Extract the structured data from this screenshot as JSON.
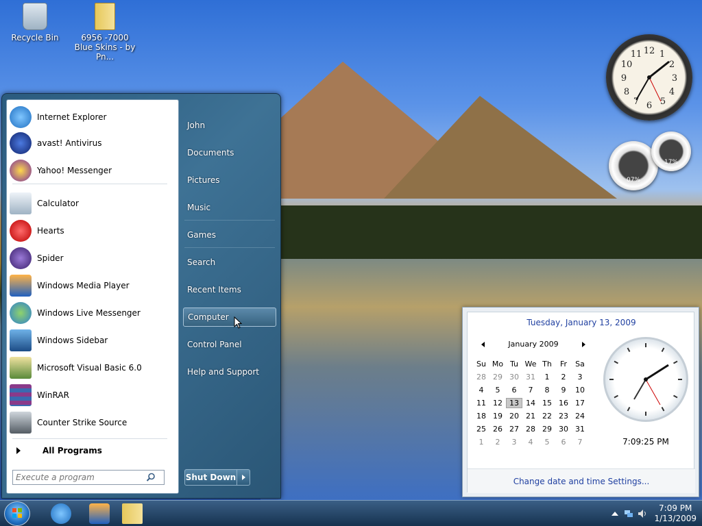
{
  "desktop": {
    "icons": [
      {
        "label": "Recycle Bin"
      },
      {
        "label": "6956 -7000 Blue Skins - by Pn..."
      }
    ]
  },
  "start_menu": {
    "pinned": [
      {
        "label": "Internet Explorer",
        "icon": "ie-icon"
      },
      {
        "label": "avast! Antivirus",
        "icon": "avast-icon"
      },
      {
        "label": "Yahoo! Messenger",
        "icon": "yahoo-icon"
      }
    ],
    "recent": [
      {
        "label": "Calculator",
        "icon": "calculator-icon"
      },
      {
        "label": "Hearts",
        "icon": "hearts-icon"
      },
      {
        "label": "Spider",
        "icon": "spider-icon"
      },
      {
        "label": "Windows Media Player",
        "icon": "media-player-icon"
      },
      {
        "label": "Windows Live Messenger",
        "icon": "messenger-icon"
      },
      {
        "label": "Windows Sidebar",
        "icon": "sidebar-icon"
      },
      {
        "label": "Microsoft Visual Basic 6.0",
        "icon": "vb-icon"
      },
      {
        "label": "WinRAR",
        "icon": "winrar-icon"
      },
      {
        "label": "Counter Strike Source",
        "icon": "cs-icon"
      }
    ],
    "all_programs": "All Programs",
    "search_placeholder": "Execute a program",
    "right_items": [
      "John",
      "Documents",
      "Pictures",
      "Music",
      "Games",
      "Search",
      "Recent Items",
      "Computer",
      "Control Panel",
      "Help and Support"
    ],
    "highlighted": "Computer",
    "shutdown": "Shut Down"
  },
  "calendar": {
    "date_title": "Tuesday, January 13, 2009",
    "month": "January 2009",
    "weekdays": [
      "Su",
      "Mo",
      "Tu",
      "We",
      "Th",
      "Fr",
      "Sa"
    ],
    "days": [
      [
        "28",
        "29",
        "30",
        "31",
        "1",
        "2",
        "3"
      ],
      [
        "4",
        "5",
        "6",
        "7",
        "8",
        "9",
        "10"
      ],
      [
        "11",
        "12",
        "13",
        "14",
        "15",
        "16",
        "17"
      ],
      [
        "18",
        "19",
        "20",
        "21",
        "22",
        "23",
        "24"
      ],
      [
        "25",
        "26",
        "27",
        "28",
        "29",
        "30",
        "31"
      ],
      [
        "1",
        "2",
        "3",
        "4",
        "5",
        "6",
        "7"
      ]
    ],
    "today": "13",
    "time": "7:09:25 PM",
    "settings_link": "Change date and time Settings..."
  },
  "gadgets": {
    "cpu_percent": "07%",
    "mem_percent": "17%"
  },
  "taskbar": {
    "time": "7:09 PM",
    "date": "1/13/2009"
  }
}
